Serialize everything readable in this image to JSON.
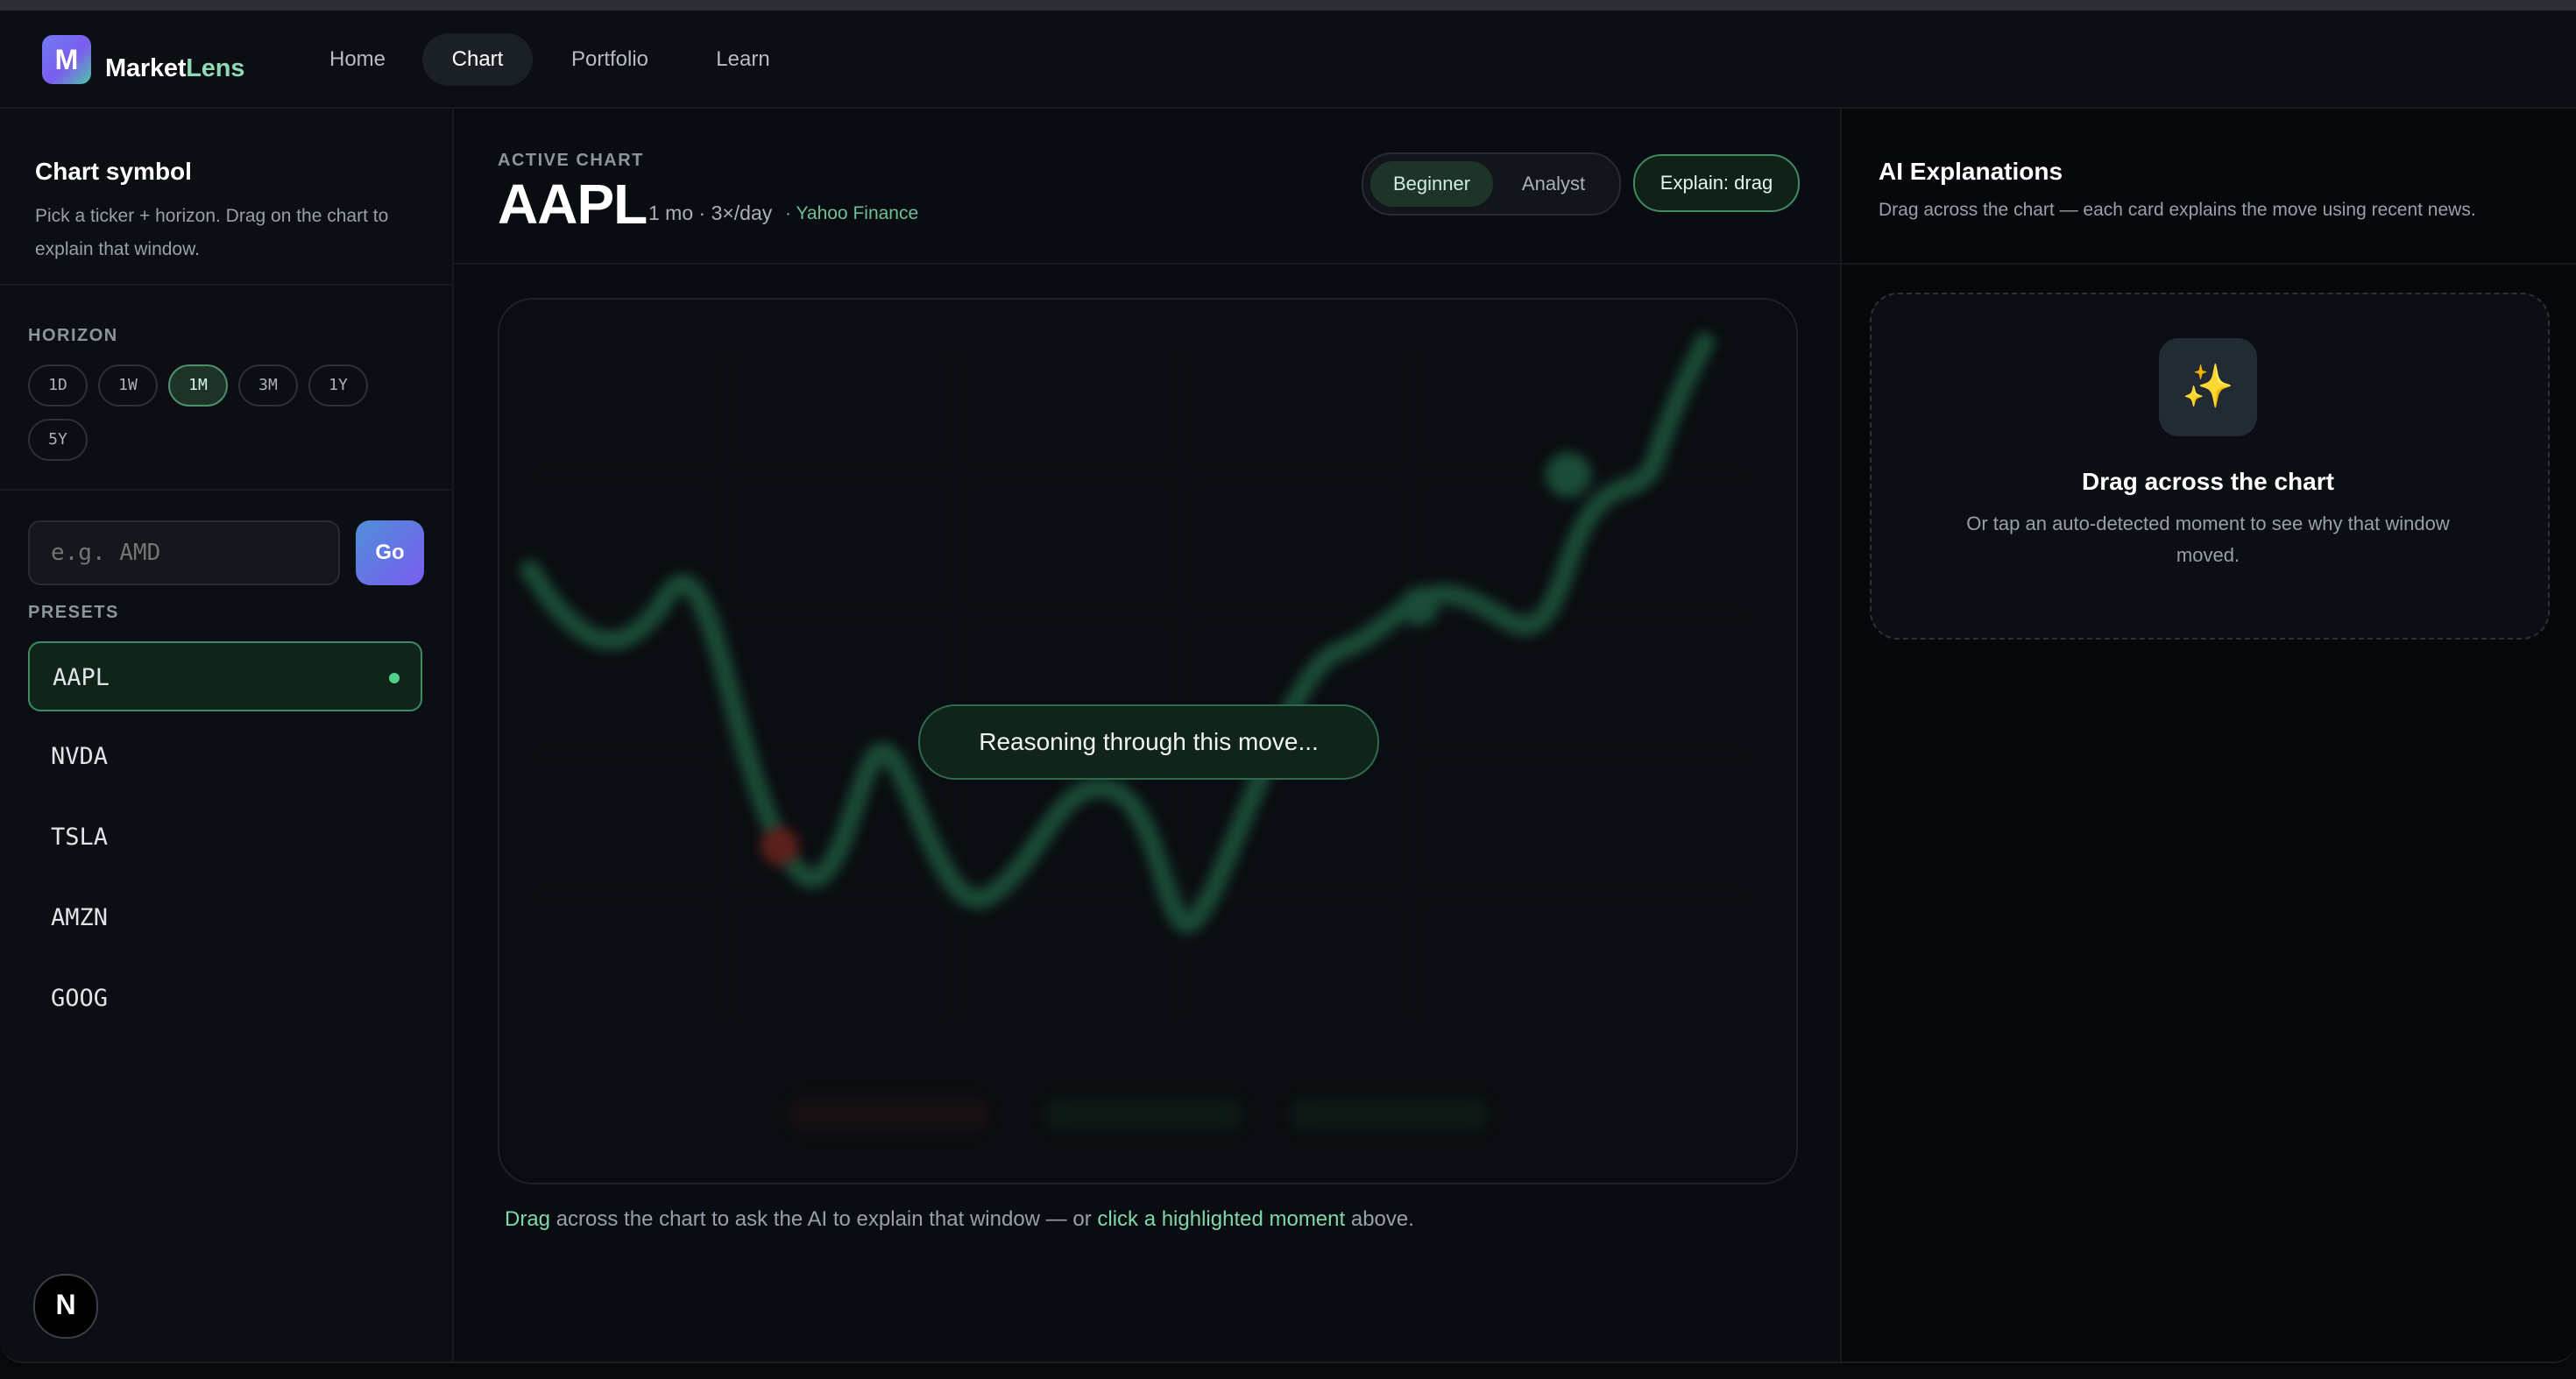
{
  "brand": {
    "name_part1": "Market",
    "name_part2": "Lens",
    "logo_letter": "M"
  },
  "nav": {
    "home": "Home",
    "chart": "Chart",
    "portfolio": "Portfolio",
    "learn": "Learn",
    "active": "Chart"
  },
  "sidebar": {
    "title": "Chart symbol",
    "subtitle_line1": "Pick a ticker + horizon. Drag on the chart to",
    "subtitle_line2": "explain that window.",
    "horizon_label": "HORIZON",
    "horizons": [
      "1D",
      "1W",
      "1M",
      "3M",
      "1Y",
      "5Y"
    ],
    "selected_horizon": "1M",
    "search_placeholder": "e.g. AMD",
    "go_label": "Go",
    "presets_label": "PRESETS",
    "presets": [
      "AAPL",
      "NVDA",
      "TSLA",
      "AMZN",
      "GOOG"
    ],
    "selected_preset": "AAPL",
    "footer_badge": "N"
  },
  "main": {
    "eyebrow": "ACTIVE CHART",
    "symbol": "AAPL",
    "meta": "1 mo · 3×/day",
    "source": "· Yahoo Finance",
    "mode_beginner": "Beginner",
    "mode_analyst": "Analyst",
    "selected_mode": "Beginner",
    "explain_button": "Explain: drag",
    "overlay_status": "Reasoning through this move...",
    "note_drag": "Drag",
    "note_mid": " across the chart to ask the AI to explain that window — or ",
    "note_click": "click a highlighted moment",
    "note_end": " above."
  },
  "aside": {
    "title": "AI Explanations",
    "subtitle": "Drag across the chart — each card explains the move using recent news.",
    "empty_icon": "sparkles-icon",
    "empty_title": "Drag across the chart",
    "empty_body_line1": "Or tap an auto-detected moment to see why that window",
    "empty_body_line2": "moved."
  },
  "colors": {
    "accent_green": "#7fd8a9",
    "brand_purple": "#6f7cf0",
    "background": "#0a0d11"
  }
}
